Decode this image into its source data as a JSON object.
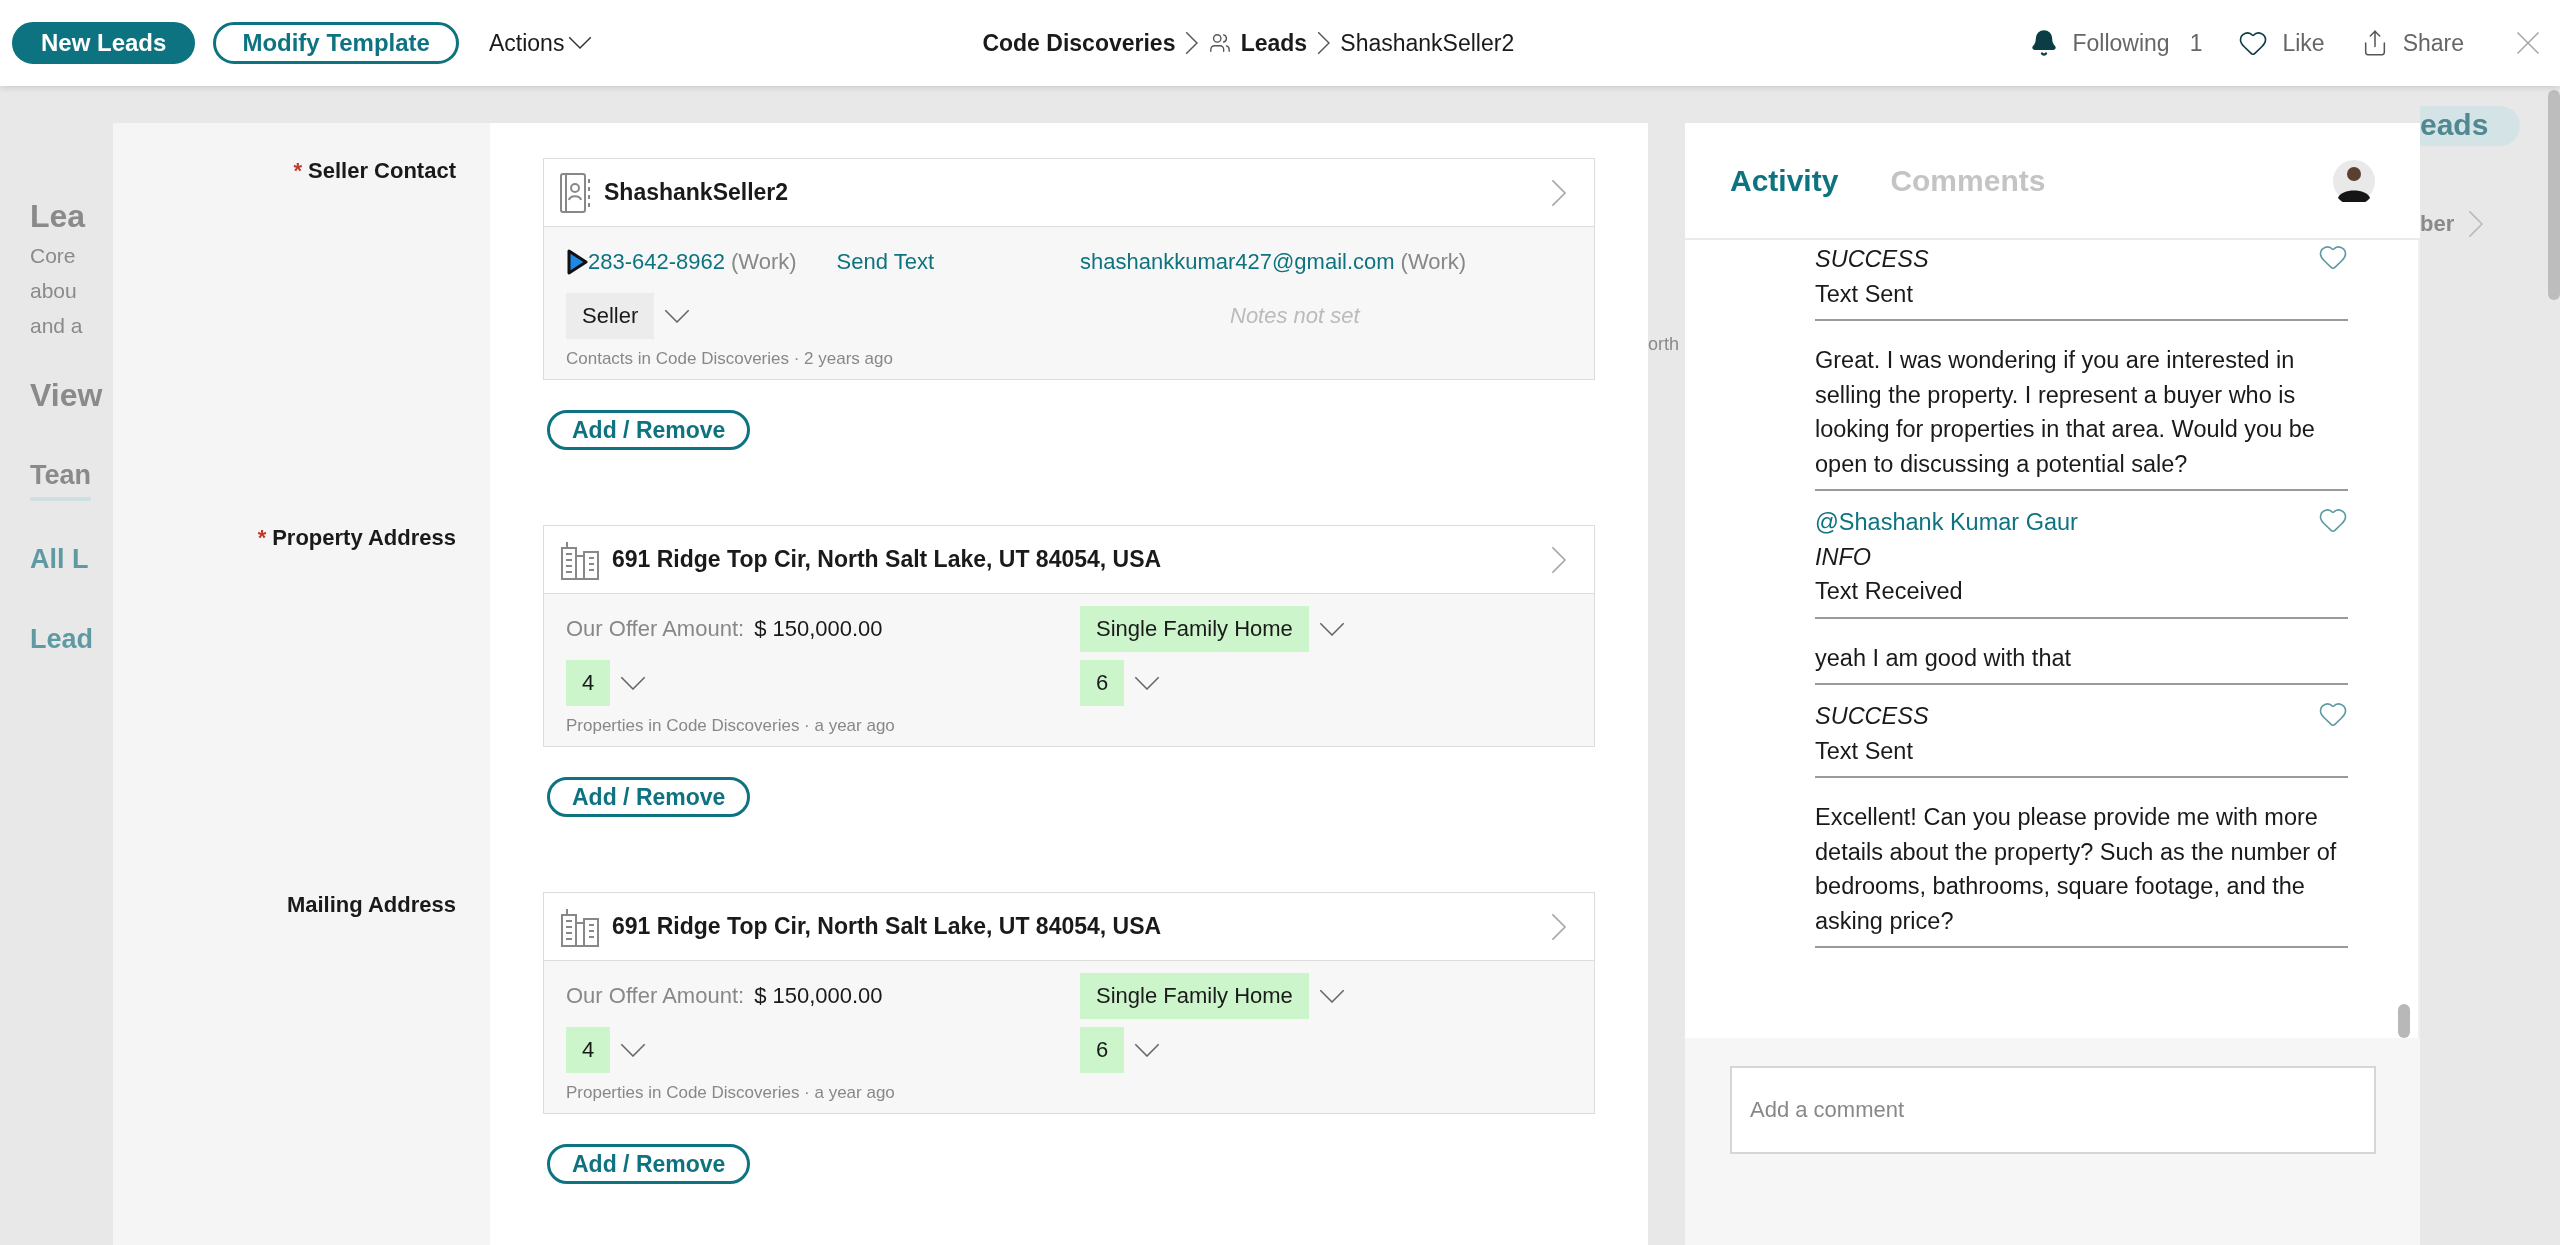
{
  "toolbar": {
    "buttons": [
      {
        "label": "New Leads",
        "kind": "filled"
      },
      {
        "label": "Modify Template",
        "kind": "outline"
      }
    ],
    "actions": "Actions"
  },
  "breadcrumb": [
    {
      "label": "Code Discoveries",
      "kind": "text"
    },
    {
      "label": "Leads",
      "kind": "group"
    },
    {
      "label": "ShashankSeller2",
      "kind": "current"
    }
  ],
  "header_actions": {
    "following": "Following",
    "following_count": "1",
    "like": "Like",
    "share": "Share"
  },
  "background": {
    "left": [
      {
        "text": "Lea",
        "kind": "title"
      },
      {
        "text": "Core",
        "kind": "body"
      },
      {
        "text": "abou",
        "kind": "body"
      },
      {
        "text": "and a",
        "kind": "body"
      },
      {
        "text": "View",
        "kind": "title"
      },
      {
        "text": "Tean",
        "kind": "tab"
      },
      {
        "text": "All L",
        "kind": "link"
      },
      {
        "text": "Lead",
        "kind": "link"
      }
    ],
    "middle": "orth",
    "pill": "eads",
    "right_item": "ber"
  },
  "form": {
    "required_mark": "*",
    "sections": [
      {
        "label": "Seller Contact",
        "required": true,
        "kind": "contact",
        "card": {
          "title": "ShashankSeller2",
          "phone": "283-642-8962",
          "phone_type": "(Work)",
          "send_text": "Send Text",
          "email": "shashankkumar427@gmail.com",
          "email_type": "(Work)",
          "role": "Seller",
          "notes_placeholder": "Notes not set",
          "footer": "Contacts in Code Discoveries · 2 years ago"
        },
        "button": "Add / Remove"
      },
      {
        "label": "Property Address",
        "required": true,
        "kind": "property",
        "card": {
          "title": "691 Ridge Top Cir, North Salt Lake, UT 84054, USA",
          "offer_label": "Our Offer Amount:",
          "offer_amount": "$ 150,000.00",
          "home_type": "Single Family Home",
          "beds": "4",
          "baths": "6",
          "footer": "Properties in Code Discoveries · a year ago"
        },
        "button": "Add / Remove"
      },
      {
        "label": "Mailing Address",
        "required": false,
        "kind": "property",
        "card": {
          "title": "691 Ridge Top Cir, North Salt Lake, UT 84054, USA",
          "offer_label": "Our Offer Amount:",
          "offer_amount": "$ 150,000.00",
          "home_type": "Single Family Home",
          "beds": "4",
          "baths": "6",
          "footer": "Properties in Code Discoveries · a year ago"
        },
        "button": "Add / Remove"
      }
    ]
  },
  "activity": {
    "tabs": [
      {
        "label": "Activity",
        "selected": true
      },
      {
        "label": "Comments",
        "selected": false
      }
    ],
    "items": [
      {
        "kind": "event",
        "status": "SUCCESS",
        "event": "Text Sent"
      },
      {
        "kind": "message",
        "text": "Great. I was wondering if you are interested in selling the property. I represent a buyer who is looking for properties in that area. Would you be open to discussing a potential sale?"
      },
      {
        "kind": "event",
        "mention": "@Shashank Kumar Gaur",
        "status": "INFO",
        "event": "Text Received"
      },
      {
        "kind": "message",
        "text": "yeah I am good with that"
      },
      {
        "kind": "event",
        "status": "SUCCESS",
        "event": "Text Sent"
      },
      {
        "kind": "message",
        "text": "Excellent! Can you please provide me with more details about the property? Such as the number of bedrooms, bathrooms, square footage, and the asking price?"
      }
    ],
    "comment_placeholder": "Add a comment"
  }
}
